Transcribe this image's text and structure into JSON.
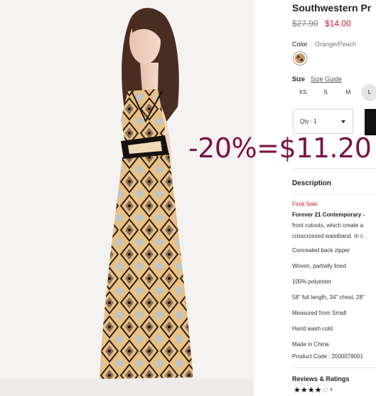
{
  "product": {
    "title": "Southwestern Pr",
    "price_original": "$27.90",
    "price_sale": "$14.00"
  },
  "color": {
    "label": "Color",
    "separator": ":",
    "value": "Orange/Peach"
  },
  "size": {
    "label": "Size",
    "guide_label": "Size Guide",
    "options": [
      "XS",
      "S",
      "M",
      "L"
    ],
    "selected": "L"
  },
  "quantity": {
    "label": "Qty : 1"
  },
  "description": {
    "heading": "Description",
    "final_sale": "Final Sale",
    "brand_line": "Forever 21 Contemporary -",
    "line2": "front cutouts, which create a",
    "line3": "crisscrossed waistband. In c",
    "bullets": [
      "Concealed back zipper",
      "Woven, partially lined",
      "100% polyester",
      "58\" full length, 34\" chest, 28\"",
      "Measured from Small",
      "Hand wash cold",
      "Made in China",
      "Product Code : 2000078001"
    ]
  },
  "reviews": {
    "heading": "Reviews & Ratings",
    "rating": 4,
    "max_rating": 5,
    "count": "4"
  },
  "annotation": {
    "text": "-20%=$11.20"
  }
}
